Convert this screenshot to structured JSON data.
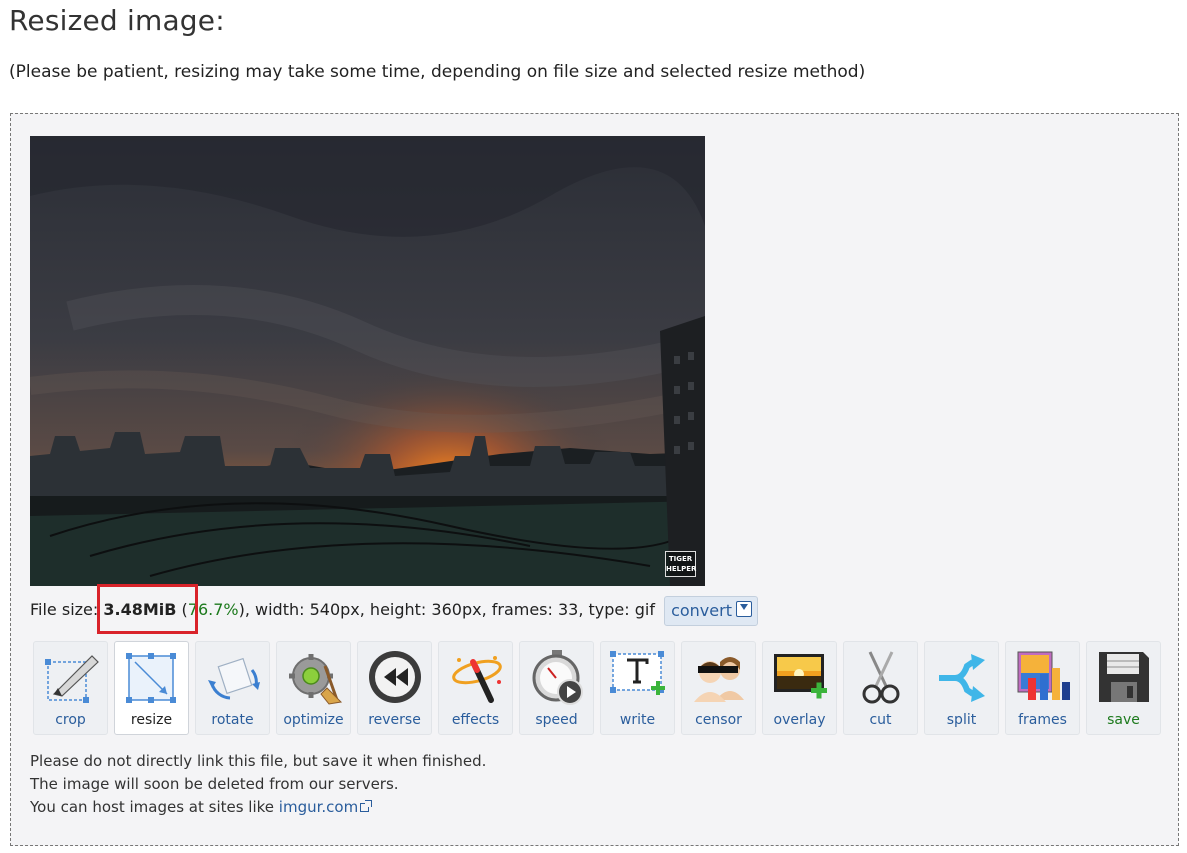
{
  "header": {
    "title": "Resized image:",
    "note": "(Please be patient, resizing may take some time, depending on file size and selected resize method)"
  },
  "image": {
    "watermark_line1": "TIGER",
    "watermark_line2": "HELPER"
  },
  "file_info": {
    "prefix": "File size: ",
    "size": "3.48MiB",
    "paren_open": " (",
    "percent": "76.7%",
    "rest": "), width: 540px, height: 360px, frames: 33, type: gif",
    "convert_label": "convert"
  },
  "toolbar": {
    "items": [
      {
        "label": "crop",
        "icon": "crop-icon"
      },
      {
        "label": "resize",
        "icon": "resize-icon"
      },
      {
        "label": "rotate",
        "icon": "rotate-icon"
      },
      {
        "label": "optimize",
        "icon": "optimize-icon"
      },
      {
        "label": "reverse",
        "icon": "reverse-icon"
      },
      {
        "label": "effects",
        "icon": "effects-icon"
      },
      {
        "label": "speed",
        "icon": "speed-icon"
      },
      {
        "label": "write",
        "icon": "write-icon"
      },
      {
        "label": "censor",
        "icon": "censor-icon"
      },
      {
        "label": "overlay",
        "icon": "overlay-icon"
      },
      {
        "label": "cut",
        "icon": "cut-icon"
      },
      {
        "label": "split",
        "icon": "split-icon"
      },
      {
        "label": "frames",
        "icon": "frames-icon"
      },
      {
        "label": "save",
        "icon": "save-icon"
      }
    ],
    "active": "resize"
  },
  "notes": {
    "line1": "Please do not directly link this file, but save it when finished.",
    "line2": "The image will soon be deleted from our servers.",
    "line3_prefix": "You can host images at sites like ",
    "link": "imgur.com"
  },
  "colors": {
    "link": "#2a5d9c",
    "percent": "#1d7a1d",
    "highlight": "#d9232a"
  }
}
